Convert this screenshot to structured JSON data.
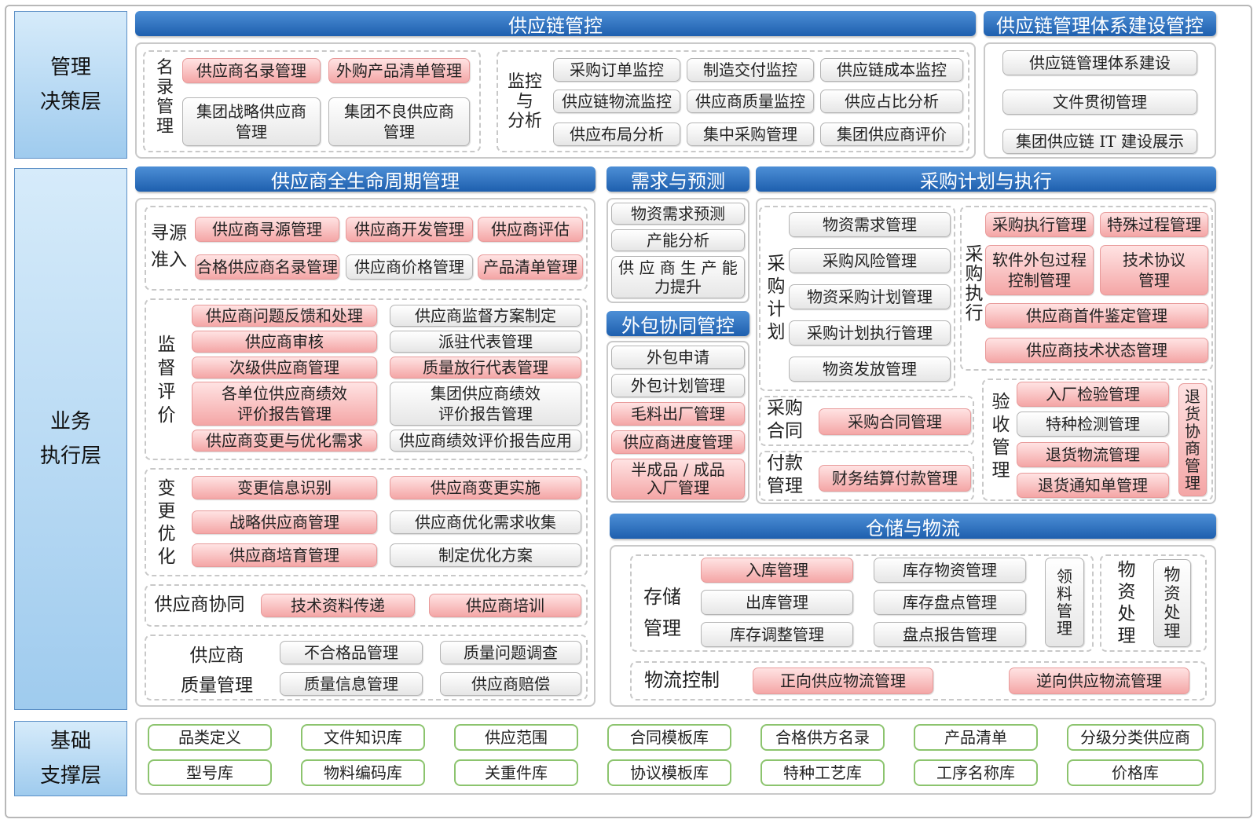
{
  "layers": {
    "decision": "管理\n决策层",
    "execution": "业务\n执行层",
    "foundation": "基础\n支撑层"
  },
  "headers": {
    "supply_chain_control": "供应链管控",
    "system_building": "供应链管理体系建设管控",
    "supplier_lifecycle": "供应商全生命周期管理",
    "demand_forecast": "需求与预测",
    "procurement_plan": "采购计划与执行",
    "outsourcing": "外包协同管控",
    "warehouse": "仓储与物流"
  },
  "roster": {
    "label": "名录管理",
    "items": [
      "供应商名录管理",
      "外购产品清单管理",
      "集团战略供应商\n管理",
      "集团不良供应商\n管理"
    ]
  },
  "monitor": {
    "label": "监控\n与\n分析",
    "items": [
      "采购订单监控",
      "制造交付监控",
      "供应链成本监控",
      "供应链物流监控",
      "供应商质量监控",
      "供应占比分析",
      "供应布局分析",
      "集中采购管理",
      "集团供应商评价"
    ]
  },
  "system_items": [
    "供应链管理体系建设",
    "文件贯彻管理",
    "集团供应链 IT 建设展示"
  ],
  "sourcing": {
    "label": "寻源\n准入",
    "items": [
      "供应商寻源管理",
      "供应商开发管理",
      "供应商评估",
      "合格供应商名录管理",
      "供应商价格管理",
      "产品清单管理"
    ]
  },
  "supervision": {
    "label": "监督评价",
    "items": [
      "供应商问题反馈和处理",
      "供应商监督方案制定",
      "供应商审核",
      "派驻代表管理",
      "次级供应商管理",
      "质量放行代表管理",
      "各单位供应商绩效\n评价报告管理",
      "集团供应商绩效\n评价报告管理",
      "供应商变更与优化需求",
      "供应商绩效评价报告应用"
    ]
  },
  "change": {
    "label": "变更优化",
    "items": [
      "变更信息识别",
      "供应商变更实施",
      "战略供应商管理",
      "供应商优化需求收集",
      "供应商培育管理",
      "制定优化方案"
    ]
  },
  "collab": {
    "label": "供应商协同",
    "items": [
      "技术资料传递",
      "供应商培训"
    ]
  },
  "quality": {
    "label": "供应商\n质量管理",
    "items": [
      "不合格品管理",
      "质量问题调查",
      "质量信息管理",
      "供应商赔偿"
    ]
  },
  "demand_items": [
    "物资需求预测",
    "产能分析",
    "供 应 商 生 产 能\n力提升"
  ],
  "outsourcing_items": [
    "外包申请",
    "外包计划管理",
    "毛料出厂管理",
    "供应商进度管理",
    "半成品 / 成品\n入厂管理"
  ],
  "purchase_plan": {
    "label": "采购计划",
    "items": [
      "物资需求管理",
      "采购风险管理",
      "物资采购计划管理",
      "采购计划执行管理",
      "物资发放管理"
    ]
  },
  "purchase_exec": {
    "label": "采购执行",
    "items": [
      "采购执行管理",
      "特殊过程管理",
      "软件外包过程\n控制管理",
      "技术协议\n管理",
      "供应商首件鉴定管理",
      "供应商技术状态管理"
    ]
  },
  "contract": {
    "label": "采购\n合同",
    "item": "采购合同管理"
  },
  "payment": {
    "label": "付款\n管理",
    "item": "财务结算付款管理"
  },
  "acceptance": {
    "label": "验收管理",
    "items": [
      "入厂检验管理",
      "特种检测管理",
      "退货物流管理",
      "退货通知单管理"
    ],
    "side": "退货协商管理"
  },
  "storage": {
    "label": "存储\n管理",
    "items": [
      "入库管理",
      "库存物资管理",
      "出库管理",
      "库存盘点管理",
      "库存调整管理",
      "盘点报告管理"
    ],
    "material_issue": "领料管理"
  },
  "disposal": {
    "label": "物资处理",
    "item": "物资处理"
  },
  "logistics": {
    "label": "物流控制",
    "items": [
      "正向供应物流管理",
      "逆向供应物流管理"
    ]
  },
  "foundation_items": [
    "品类定义",
    "文件知识库",
    "供应范围",
    "合同模板库",
    "合格供方名录",
    "产品清单",
    "分级分类供应商",
    "型号库",
    "物料编码库",
    "关重件库",
    "协议模板库",
    "特种工艺库",
    "工序名称库",
    "价格库"
  ],
  "colors": {
    "header_blue": "#2b6fbf",
    "layer_blue": "#bcdcf5",
    "pink": "#f6b3b3",
    "green_border": "#8cc46e"
  }
}
